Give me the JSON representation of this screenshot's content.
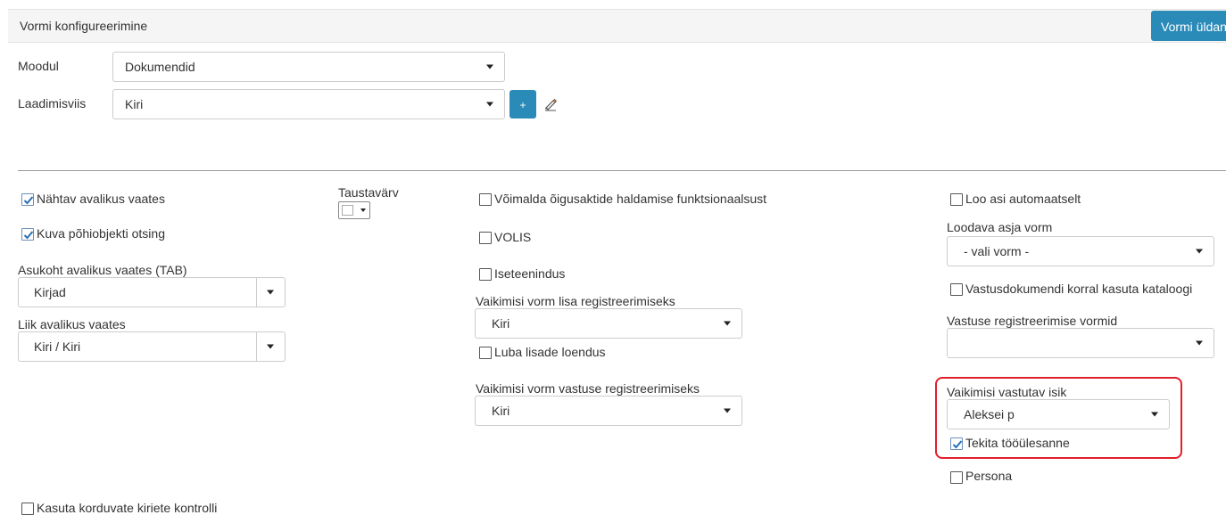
{
  "header": {
    "title": "Vormi konfigureerimine",
    "button_label": "Vormi üldandmed"
  },
  "module": {
    "label": "Moodul",
    "value": "Dokumendid"
  },
  "creation_method": {
    "label": "Laadimisviis",
    "value": "Kiri",
    "add_label": "+"
  },
  "col1": {
    "visible_public": {
      "label": "Nähtav avalikus vaates",
      "checked": true
    },
    "show_main_search": {
      "label": "Kuva põhiobjekti otsing",
      "checked": true
    },
    "location_tab": {
      "label": "Asukoht avalikus vaates (TAB)",
      "value": "Kirjad"
    },
    "kind_public": {
      "label": "Liik avalikus vaates",
      "value": "Kiri / Kiri"
    },
    "duplicate_check": {
      "label": "Kasuta korduvate kiriete kontrolli",
      "checked": false
    }
  },
  "col2": {
    "background_color": {
      "label": "Taustavärv"
    }
  },
  "col3": {
    "legal_acts": {
      "label": "Võimalda õigusaktide haldamise funktsionaalsust",
      "checked": false
    },
    "volis": {
      "label": "VOLIS",
      "checked": false
    },
    "self_service": {
      "label": "Iseteenindus",
      "checked": false
    },
    "default_attachment_form": {
      "label": "Vaikimisi vorm lisa registreerimiseks",
      "value": "Kiri"
    },
    "allow_attachment_count": {
      "label": "Luba lisade loendus",
      "checked": false
    },
    "default_reply_form": {
      "label": "Vaikimisi vorm vastuse registreerimiseks",
      "value": "Kiri"
    }
  },
  "col4": {
    "auto_case": {
      "label": "Loo asi automaatselt",
      "checked": false
    },
    "case_form": {
      "label": "Loodava asja vorm",
      "value": "- vali vorm -"
    },
    "reply_catalog": {
      "label": "Vastusdokumendi korral kasuta kataloogi",
      "checked": false
    },
    "reply_reg_forms": {
      "label": "Vastuse registreerimise vormid",
      "value": ""
    },
    "default_responsible": {
      "label": "Vaikimisi vastutav isik",
      "value": "Aleksei p"
    },
    "create_task": {
      "label": "Tekita tööülesanne",
      "checked": true
    },
    "persona": {
      "label": "Persona",
      "checked": false
    }
  },
  "colors": {
    "accent": "#2a8ab8",
    "highlight": "#e0202a"
  }
}
